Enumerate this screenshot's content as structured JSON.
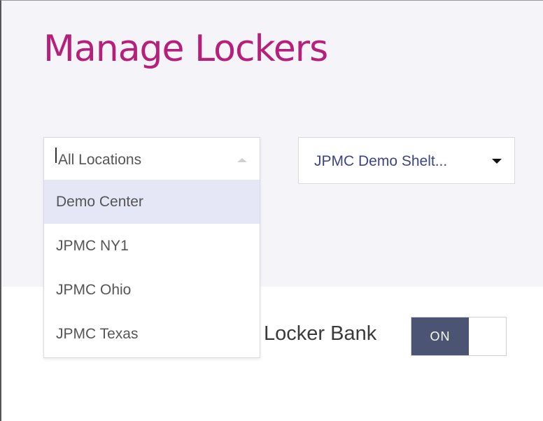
{
  "page": {
    "title": "Manage Lockers"
  },
  "location_select": {
    "value": "All Locations",
    "expanded": true,
    "options": [
      {
        "label": "Demo Center",
        "highlighted": true
      },
      {
        "label": "JPMC NY1",
        "highlighted": false
      },
      {
        "label": "JPMC Ohio",
        "highlighted": false
      },
      {
        "label": "JPMC Texas",
        "highlighted": false
      }
    ]
  },
  "shelter_select": {
    "value": "JPMC Demo Shelt..."
  },
  "locker_bank": {
    "label": "Locker Bank",
    "toggle_label": "ON",
    "state": "on"
  },
  "colors": {
    "title": "#b5217a",
    "panel_background": "#f4f4f9",
    "highlight": "#e5e6f6",
    "toggle_on": "#4b5573",
    "link_text": "#3d4582"
  },
  "icons": [
    "caret-up-icon",
    "caret-down-icon"
  ]
}
